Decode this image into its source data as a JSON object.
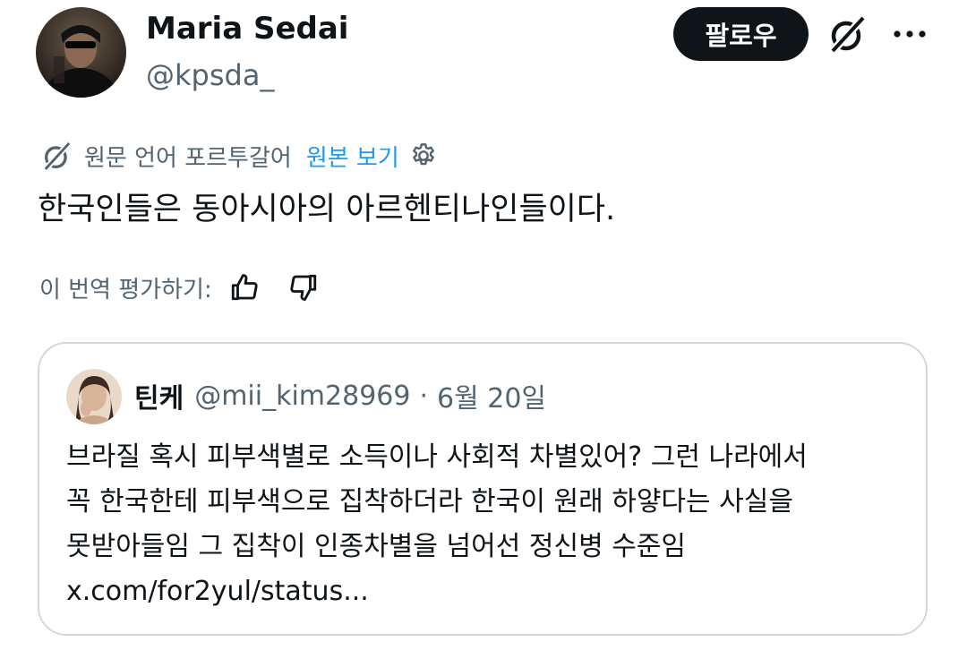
{
  "tweet": {
    "author": {
      "display_name": "Maria Sedai",
      "handle": "@kpsda_"
    },
    "follow_label": "팔로우",
    "translation": {
      "meta": "원문 언어 포르투갈어",
      "show_original": "원본 보기"
    },
    "text": "한국인들은 동아시아의 아르헨티나인들이다.",
    "rate": {
      "label": "이 번역 평가하기:"
    }
  },
  "quoted": {
    "name": "틴케",
    "handle": "@mii_kim28969",
    "separator": "·",
    "date": "6월 20일",
    "lines": [
      "브라질 혹시 피부색별로 소득이나 사회적 차별있어? 그런 나라에서",
      "꼭 한국한테 피부색으로 집착하더라 한국이 원래 하얗다는 사실을",
      "못받아들임 그 집착이 인종차별을 넘어선 정신병 수준임",
      "x.com/for2yul/status..."
    ]
  },
  "icons": {
    "grok": "grok-icon",
    "more": "more-horizontal-icon",
    "translate": "grok-translate-icon",
    "settings": "gear-icon",
    "thumbs_up": "thumbs-up-icon",
    "thumbs_down": "thumbs-down-icon"
  },
  "colors": {
    "text_primary": "#0f1419",
    "text_secondary": "#536471",
    "link": "#1d9bf0",
    "follow_bg": "#0f1419",
    "border": "#cfd9de"
  }
}
